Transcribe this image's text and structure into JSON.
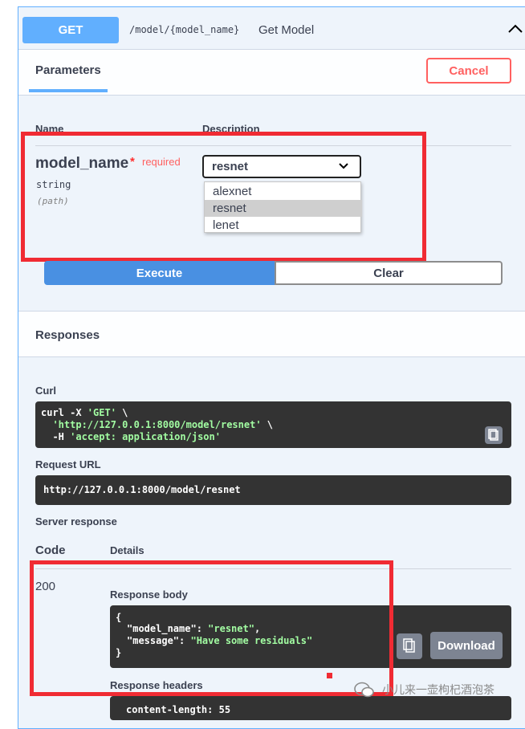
{
  "operation": {
    "method": "GET",
    "path": "/model/{model_name}",
    "summary": "Get Model"
  },
  "parameters_section": {
    "tab_label": "Parameters",
    "cancel_label": "Cancel",
    "col_name": "Name",
    "col_description": "Description"
  },
  "parameter": {
    "name": "model_name",
    "star": "*",
    "required": "required",
    "type": "string",
    "location": "(path)",
    "selected_value": "resnet",
    "options": [
      "alexnet",
      "resnet",
      "lenet"
    ]
  },
  "actions": {
    "execute": "Execute",
    "clear": "Clear"
  },
  "responses": {
    "title": "Responses",
    "curl_label": "Curl",
    "curl_lines": [
      "curl -X ",
      "'GET'",
      " \\",
      "'http://127.0.0.1:8000/model/resnet'",
      " \\",
      "-H ",
      "'accept: application/json'"
    ],
    "request_url_label": "Request URL",
    "request_url": "http://127.0.0.1:8000/model/resnet",
    "server_response_label": "Server response",
    "code_header": "Code",
    "details_header": "Details",
    "code": "200",
    "response_body_label": "Response body",
    "body_open": "{",
    "body_key_1": "\"model_name\"",
    "body_val_1": "\"resnet\"",
    "body_key_2": "\"message\"",
    "body_val_2": "\"Have some residuals\"",
    "body_close": "}",
    "download_label": "Download",
    "response_headers_label": "Response headers",
    "header_line": "content-length: 55"
  },
  "watermark": {
    "text": "小儿来一壶枸杞酒泡茶"
  },
  "colors": {
    "accent": "#61affe",
    "execute": "#4990e2",
    "cancel": "#ff6060",
    "annotation_red": "#f02b33",
    "code_bg": "#333333",
    "code_string": "#a2fca2"
  }
}
